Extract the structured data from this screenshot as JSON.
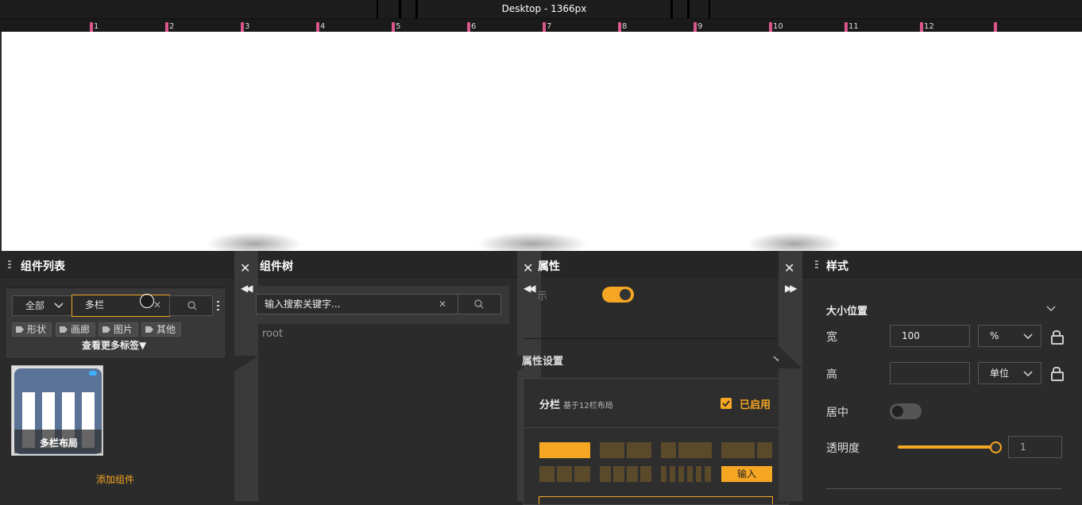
{
  "topbar": {
    "device_label": "Desktop - 1366px"
  },
  "ruler": {
    "ticks": [
      "1",
      "2",
      "3",
      "4",
      "5",
      "6",
      "7",
      "8",
      "9",
      "10",
      "11",
      "12"
    ]
  },
  "component_list": {
    "title": "组件列表",
    "filter_select": "全部",
    "search_value": "多栏",
    "tags": [
      "形状",
      "画廊",
      "图片",
      "其他"
    ],
    "more_tags": "查看更多标签▼",
    "card_label": "多栏布局",
    "add_component": "添加组件"
  },
  "component_tree": {
    "title": "组件树",
    "search_placeholder": "输入搜索关键字...",
    "root_label": "root"
  },
  "properties": {
    "title": "属性",
    "partial_label": "示",
    "section_title": "属性设置",
    "columns_title": "分栏",
    "columns_subtitle": "基于12栏布局",
    "enabled_label": "已启用",
    "input_button": "输入"
  },
  "style": {
    "title": "样式",
    "section_title": "大小位置",
    "width_label": "宽",
    "width_value": "100",
    "width_unit": "%",
    "height_label": "高",
    "height_unit": "单位",
    "center_label": "居中",
    "opacity_label": "透明度",
    "opacity_value": "1"
  },
  "colors": {
    "accent": "#f5a623",
    "ruler_tick": "#d9578a"
  }
}
